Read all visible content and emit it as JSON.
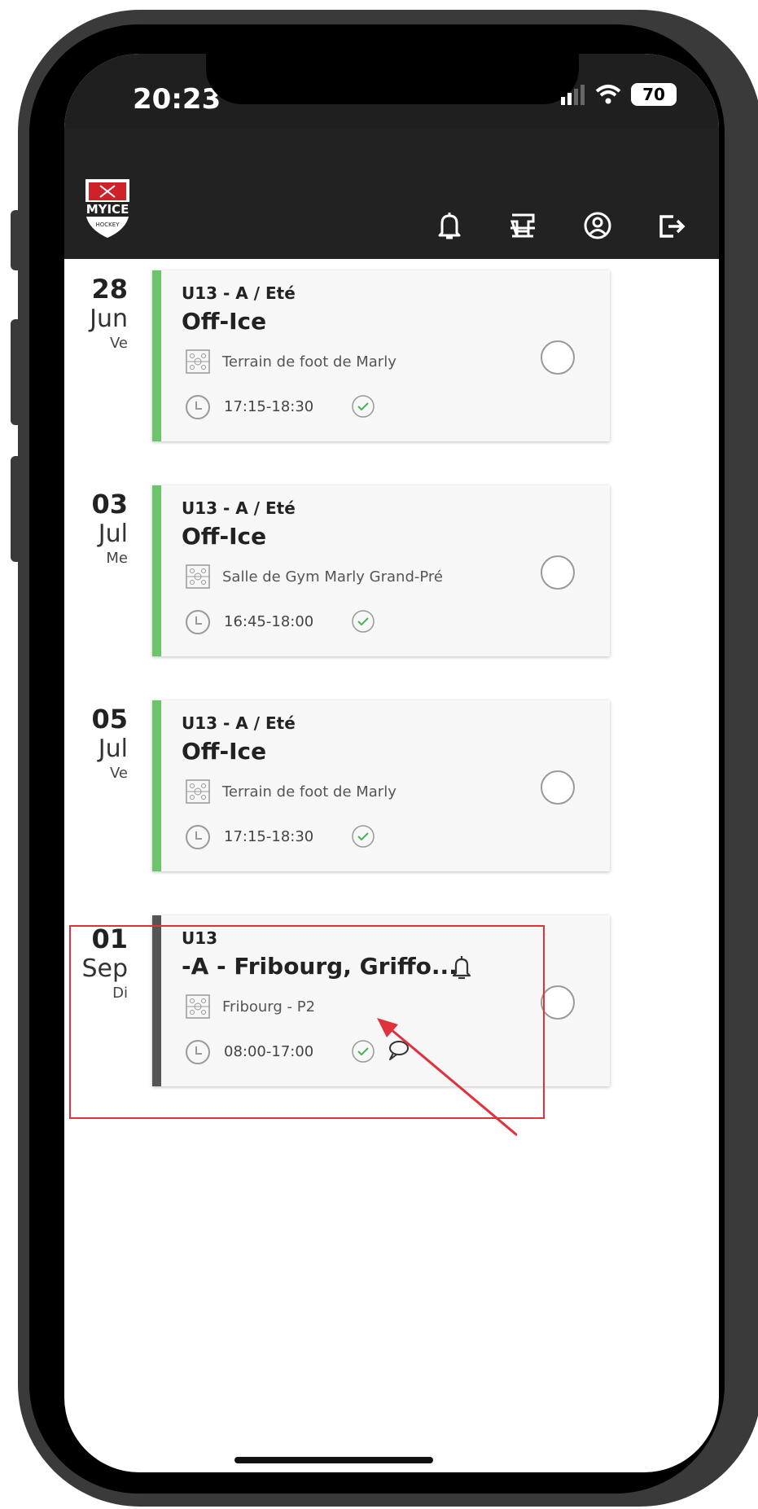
{
  "status_bar": {
    "time": "20:23",
    "battery": "70"
  },
  "app": {
    "logo_text": "MYICE",
    "logo_sub": "HOCKEY"
  },
  "header_icons": [
    "bell-icon",
    "goal-icon",
    "user-circle-icon",
    "logout-icon"
  ],
  "events": [
    {
      "day": "28",
      "month": "Jun",
      "weekday": "Ve",
      "group": "U13 - A / Eté",
      "title": "Off-Ice",
      "location": "Terrain de foot de Marly",
      "time": "17:15-18:30",
      "accent": "#6cc46b"
    },
    {
      "day": "03",
      "month": "Jul",
      "weekday": "Me",
      "group": "U13 - A / Eté",
      "title": "Off-Ice",
      "location": "Salle de Gym Marly Grand-Pré",
      "time": "16:45-18:00",
      "accent": "#6cc46b"
    },
    {
      "day": "05",
      "month": "Jul",
      "weekday": "Ve",
      "group": "U13 - A / Eté",
      "title": "Off-Ice",
      "location": "Terrain de foot de Marly",
      "time": "17:15-18:30",
      "accent": "#6cc46b"
    },
    {
      "day": "01",
      "month": "Sep",
      "weekday": "Di",
      "group": "U13",
      "title": "-A - Fribourg, Griffo...",
      "location": "Fribourg - P2",
      "time": "08:00-17:00",
      "accent": "#555555"
    }
  ],
  "colors": {
    "header_bg": "#222222",
    "check": "#4caf50",
    "highlight": "#e0323c"
  }
}
